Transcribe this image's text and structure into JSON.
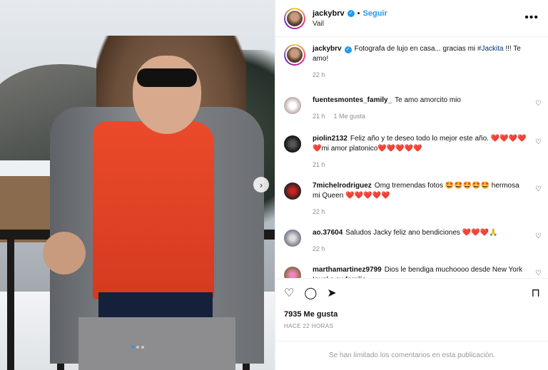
{
  "post": {
    "author": {
      "username": "jackybrv",
      "follow_label": "Seguir",
      "separator": "•",
      "location": "Vail"
    },
    "more_icon": "more-horizontal-icon",
    "carousel": {
      "total": 3,
      "active_index": 0
    },
    "caption": {
      "username": "jackybrv",
      "text_before": "Fotografa de lujo en casa... gracias mi ",
      "hashtag": "#Jackita",
      "text_after": " !!! Te amo!",
      "time": "22 h"
    },
    "comments": [
      {
        "username": "fuentesmontes_family_",
        "text": "Te amo amorcito mio",
        "time": "21 h",
        "likes": "1 Me gusta"
      },
      {
        "username": "piolin2132",
        "text": "Feliz año y te deseo todo lo mejor este año. ❤️❤️❤️❤️❤️mi amor platonico❤️❤️❤️❤️❤️",
        "time": "21 h",
        "likes": ""
      },
      {
        "username": "7michelrodriguez",
        "text": "Omg tremendas fotos 🤩🤩🤩🤩🤩 hermosa mi Queen ❤️❤️❤️❤️❤️",
        "time": "22 h",
        "likes": ""
      },
      {
        "username": "ao.37604",
        "text": "Saludos Jacky feliz ano bendiciones ❤️❤️❤️🙏",
        "time": "22 h",
        "likes": ""
      },
      {
        "username": "marthamartinez9799",
        "text": "Dios le bendiga muchoooo desde New York Igual a su familia",
        "time": "",
        "likes": ""
      }
    ],
    "actions": {
      "icons": [
        "heart-icon",
        "comment-icon",
        "share-icon",
        "bookmark-icon"
      ]
    },
    "likes_text": "7935 Me gusta",
    "time_ago": "HACE 22 HORAS",
    "comments_limited": "Se han limitado los comentarios en esta publicación."
  },
  "colors": {
    "accent": "#1d9bf0",
    "heart_red": "#e0245e"
  }
}
